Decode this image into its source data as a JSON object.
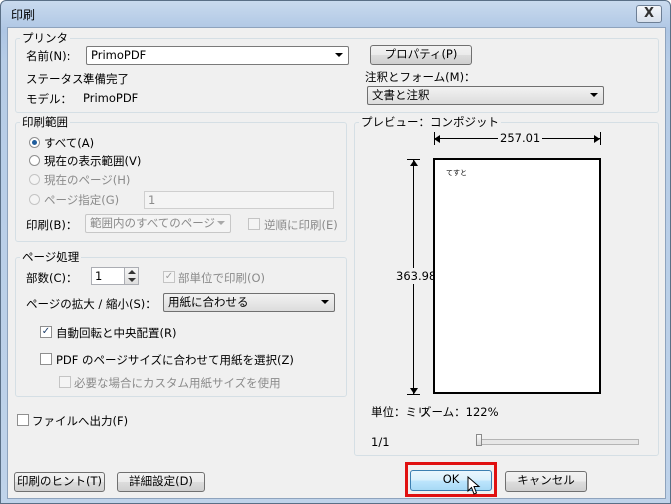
{
  "window": {
    "title": "印刷",
    "close": "X"
  },
  "printer": {
    "group_label": "プリンタ",
    "name_label": "名前(N):",
    "name_value": "PrimoPDF",
    "properties_button": "プロパティ(P)",
    "status_label": "ステータス：",
    "status_value": "準備完了",
    "model_label": "モデル：",
    "model_value": "PrimoPDF"
  },
  "comments": {
    "label": "注釈とフォーム(M)：",
    "value": "文書と注釈"
  },
  "range": {
    "group_label": "印刷範囲",
    "all": "すべて(A)",
    "current_view": "現在の表示範囲(V)",
    "current_page": "現在のページ(H)",
    "pages": "ページ指定(G)",
    "pages_value": "1",
    "print_label": "印刷(B)：",
    "print_value": "範囲内のすべてのページ",
    "reverse": "逆順に印刷(E)"
  },
  "handling": {
    "group_label": "ページ処理",
    "copies_label": "部数(C)：",
    "copies_value": "1",
    "collate": "部単位で印刷(O)",
    "scaling_label": "ページの拡大 / 縮小(S)：",
    "scaling_value": "用紙に合わせる",
    "auto_rotate": "自動回転と中央配置(R)",
    "choose_paper": "PDF のページサイズに合わせて用紙を選択(Z)",
    "custom_paper": "必要な場合にカスタム用紙サイズを使用"
  },
  "print_to_file": "ファイルへ出力(F)",
  "preview": {
    "group_label": "プレビュー：コンポジット",
    "width": "257.01",
    "height": "363.98",
    "page_text": "てすと",
    "units": "単位：ミリ",
    "zoom": "ズーム：122%",
    "page_counter": "1/1"
  },
  "buttons": {
    "tips": "印刷のヒント(T)",
    "advanced": "詳細設定(D)",
    "ok": "OK",
    "cancel": "キャンセル"
  }
}
